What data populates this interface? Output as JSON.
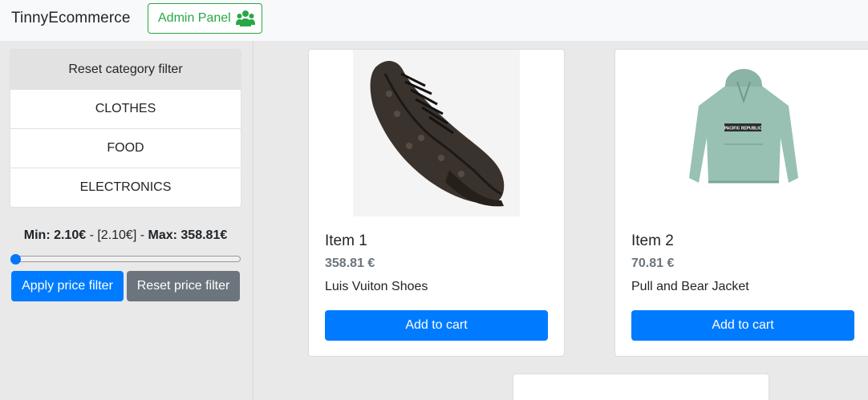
{
  "navbar": {
    "brand": "TinnyEcommerce",
    "admin_label": "Admin Panel",
    "admin_icon": "users-icon",
    "admin_color": "#28a745"
  },
  "sidebar": {
    "reset_category": "Reset category filter",
    "categories": [
      "CLOTHES",
      "FOOD",
      "ELECTRONICS"
    ],
    "price": {
      "min_label": "Min: 2.10€",
      "separator_left": " - ",
      "current": "[2.10€]",
      "separator_right": " - ",
      "max_label": "Max: 358.81€",
      "slider_value": 2.1,
      "slider_min": 2.1,
      "slider_max": 358.81
    },
    "apply_label": "Apply price filter",
    "reset_label": "Reset price filter"
  },
  "products": [
    {
      "title": "Item 1",
      "price": "358.81 €",
      "description": "Luis Vuiton Shoes",
      "cart_label": "Add to cart",
      "image": "shoe-image"
    },
    {
      "title": "Item 2",
      "price": "70.81 €",
      "description": "Pull and Bear Jacket",
      "cart_label": "Add to cart",
      "image": "jacket-image",
      "jacket_print": "PACIFIC REPUBLIC"
    }
  ],
  "colors": {
    "primary": "#007bff",
    "secondary": "#6c757d",
    "success": "#28a745"
  }
}
